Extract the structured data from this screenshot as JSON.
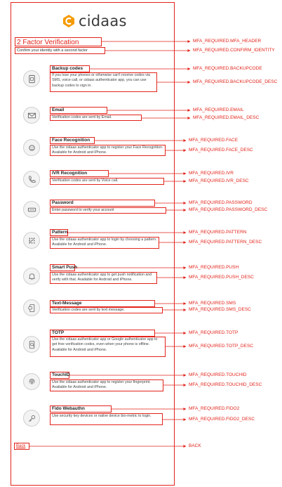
{
  "app": {
    "logo_text": "cidaas"
  },
  "header": {
    "title": "2 Factor Verification",
    "subtitle": "Confirm your identity with a second factor"
  },
  "items": [
    {
      "title": "Backup codes",
      "desc": "If you lose your phones or otherwise can't receive codes via SMS, voice call, or cidaas authenticator app, you can use backup codes to sign in.",
      "icon": "backup-code-icon"
    },
    {
      "title": "Email",
      "desc": "Verification codes are sent by Email.",
      "icon": "email-icon"
    },
    {
      "title": "Face Recognition",
      "desc": "Use the cidaas authenticator app to register your Face Recognition. Available for Android and iPhone.",
      "icon": "face-icon"
    },
    {
      "title": "IVR Recognition",
      "desc": "Verification codes are sent by Voice call.",
      "icon": "phone-icon"
    },
    {
      "title": "Password",
      "desc": "Enter password to verify your account",
      "icon": "password-icon"
    },
    {
      "title": "Pattern",
      "desc": "Use the cidaas authenticator app to login by choosing a pattern. Available for Android and iPhone.",
      "icon": "pattern-icon"
    },
    {
      "title": "Smart Push",
      "desc": "Use the cidaas authenticator app to get push notification and verify with that. Available for Android and iPhone.",
      "icon": "bell-icon"
    },
    {
      "title": "Text-Message",
      "desc": "Verification codes are sent by text message.",
      "icon": "sms-icon"
    },
    {
      "title": "TOTP",
      "desc": "Use the cidaas authenticator app or Google authenticator app to get free verification codes, even when your phone is offline. Available for Android and iPhone.",
      "icon": "totp-icon"
    },
    {
      "title": "TouchID",
      "desc": "Use the cidaas authenticator app to register your fingerprint. Available for Android and iPhone.",
      "icon": "fingerprint-icon"
    },
    {
      "title": "Fido Webauthn",
      "desc": "Use security key devices or native device bio-metric to login.",
      "icon": "security-key-icon"
    }
  ],
  "back_label": "Back",
  "annotations": [
    "MFA_REQUIRED.MFA_HEADER",
    "MFA_REQUIRED.CONFIRM_IDENTITY",
    "MFA_REQUIRED.BACKUPCODE",
    "MFA_REQUIRED.BACKUPCODE_DESC",
    "MFA_REQUIRED.EMAIL",
    "MFA_REQUIRED.EMAIL_DESC",
    "MFA_REQUIRED.FACE",
    "MFA_REQUIRED.FACE_DESC",
    "MFA_REQUIRED.IVR",
    "MFA_REQUIRED.IVR_DESC",
    "MFA_REQUIRED.PASSWORD",
    "MFA_REQUIRED.PASSWORD_DESC",
    "MFA_REQUIRED.PATTERN",
    "MFA_REQUIRED.PATTERN_DESC",
    "MFA_REQUIRED.PUSH",
    "MFA_REQUIRED.PUSH_DESC",
    "MFA_REQUIRED.SMS",
    "MFA_REQUIRED.SMS_DESC",
    "MFA_REQUIRED.TOTP",
    "MFA_REQUIRED.TOTP_DESC",
    "MFA_REQUIRED.TOUCHID",
    "MFA_REQUIRED.TOUCHID_DESC",
    "MFA_REQUIRED.FIDO2",
    "MFA_REQUIRED.FIDO2_DESC",
    "BACK"
  ],
  "colors": {
    "annotation": "#e2231a",
    "logo_accent": "#f59a00"
  }
}
